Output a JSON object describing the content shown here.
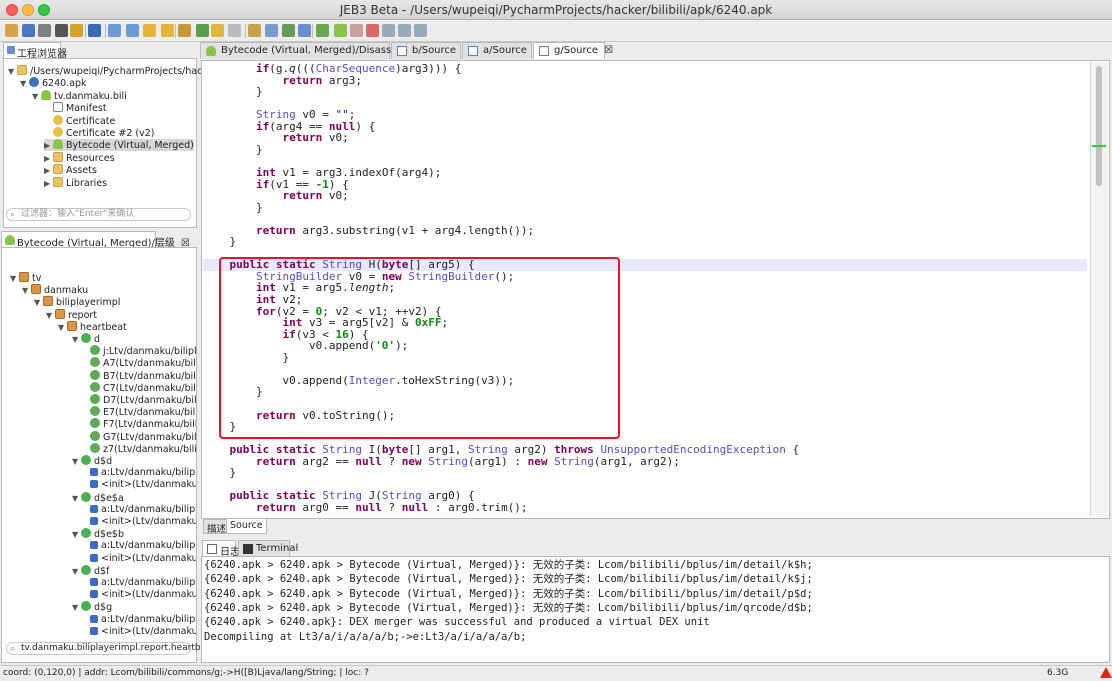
{
  "window": {
    "title": "JEB3 Beta - /Users/wupeiqi/PycharmProjects/hacker/bilibili/apk/6240.apk"
  },
  "toolbar": {
    "icons": [
      "open-folder-icon",
      "save-icon",
      "wrench-icon",
      "hammer-icon",
      "bomb-icon",
      "globe-icon",
      "import-icon",
      "export-icon",
      "back-icon",
      "forward-icon",
      "package-icon",
      "comment-icon",
      "pencil-icon",
      "document-icon",
      "table-icon",
      "copy-icon",
      "graph-icon",
      "stack-icon",
      "debug-icon",
      "play-icon",
      "pause-icon",
      "stop-icon",
      "step-into-icon",
      "step-over-icon",
      "step-out-icon"
    ]
  },
  "project_explorer": {
    "tab_label": "工程浏览器",
    "tree": [
      {
        "label": "/Users/wupeiqi/PycharmProjects/hacker/b",
        "icon": "folder-icon",
        "expanded": true
      },
      {
        "label": "6240.apk",
        "icon": "apk-icon",
        "expanded": true
      },
      {
        "label": "tv.danmaku.bili",
        "icon": "android-icon",
        "expanded": true
      },
      {
        "label": "Manifest",
        "icon": "file-icon"
      },
      {
        "label": "Certificate",
        "icon": "key-icon"
      },
      {
        "label": "Certificate #2 (v2)",
        "icon": "key-icon"
      },
      {
        "label": "Bytecode (Virtual, Merged)",
        "icon": "android-icon",
        "selected": true
      },
      {
        "label": "Resources",
        "icon": "folder-icon"
      },
      {
        "label": "Assets",
        "icon": "folder-icon"
      },
      {
        "label": "Libraries",
        "icon": "folder-icon"
      }
    ],
    "filter_placeholder": "过滤器：输入\"Enter\"来确认"
  },
  "hierarchy": {
    "tab_label": "Bytecode (Virtual, Merged)/层级",
    "close": "☒",
    "tree": [
      {
        "label": "tv",
        "type": "pkg"
      },
      {
        "label": "danmaku",
        "type": "pkg"
      },
      {
        "label": "biliplayerimpl",
        "type": "pkg"
      },
      {
        "label": "report",
        "type": "pkg"
      },
      {
        "label": "heartbeat",
        "type": "pkg"
      },
      {
        "label": "d",
        "type": "class"
      },
      {
        "label": "j:Ltv/danmaku/biliplaye",
        "type": "method"
      },
      {
        "label": "A7(Ltv/danmaku/biliplay",
        "type": "method"
      },
      {
        "label": "B7(Ltv/danmaku/biliplay",
        "type": "method"
      },
      {
        "label": "C7(Ltv/danmaku/biliplay",
        "type": "method"
      },
      {
        "label": "D7(Ltv/danmaku/biliplay",
        "type": "method"
      },
      {
        "label": "E7(Ltv/danmaku/biliplay",
        "type": "method"
      },
      {
        "label": "F7(Ltv/danmaku/biliplay",
        "type": "method"
      },
      {
        "label": "G7(Ltv/danmaku/biliplay",
        "type": "method"
      },
      {
        "label": "z7(Ltv/danmaku/biliplay",
        "type": "method"
      },
      {
        "label": "d$d",
        "type": "class"
      },
      {
        "label": "a:Ltv/danmaku/biliplaye",
        "type": "field"
      },
      {
        "label": "<init>(Ltv/danmaku/bil",
        "type": "init"
      },
      {
        "label": "d$e$a",
        "type": "class"
      },
      {
        "label": "a:Ltv/danmaku/biliplaye",
        "type": "field"
      },
      {
        "label": "<init>(Ltv/danmaku/bil",
        "type": "init"
      },
      {
        "label": "d$e$b",
        "type": "class"
      },
      {
        "label": "a:Ltv/danmaku/biliplaye",
        "type": "field"
      },
      {
        "label": "<init>(Ltv/danmaku/bil",
        "type": "init"
      },
      {
        "label": "d$f",
        "type": "class"
      },
      {
        "label": "a:Ltv/danmaku/biliplaye",
        "type": "field"
      },
      {
        "label": "<init>(Ltv/danmaku/bil",
        "type": "init"
      },
      {
        "label": "d$g",
        "type": "class"
      },
      {
        "label": "a:Ltv/danmaku/biliplaye",
        "type": "field"
      },
      {
        "label": "<init>(Ltv/danmaku/bil",
        "type": "init"
      }
    ],
    "filter_value": "tv.danmaku.biliplayerimpl.report.heartbe"
  },
  "editor_tabs": [
    {
      "label": "Bytecode (Virtual, Merged)/Disassembly",
      "active": false
    },
    {
      "label": "b/Source",
      "active": false
    },
    {
      "label": "a/Source",
      "active": false
    },
    {
      "label": "g/Source",
      "active": true,
      "close": "☒"
    }
  ],
  "bottom_tabs": {
    "describe": "描述",
    "source": "Source"
  },
  "console_tabs": {
    "log": "日志",
    "terminal": "Terminal"
  },
  "console": [
    "{6240.apk > 6240.apk > Bytecode (Virtual, Merged)}: 无效的子类: Lcom/bilibili/bplus/im/detail/k$h;",
    "{6240.apk > 6240.apk > Bytecode (Virtual, Merged)}: 无效的子类: Lcom/bilibili/bplus/im/detail/k$j;",
    "{6240.apk > 6240.apk > Bytecode (Virtual, Merged)}: 无效的子类: Lcom/bilibili/bplus/im/detail/p$d;",
    "{6240.apk > 6240.apk > Bytecode (Virtual, Merged)}: 无效的子类: Lcom/bilibili/bplus/im/qrcode/d$b;",
    "{6240.apk > 6240.apk}: DEX merger was successful and produced a virtual DEX unit",
    "Decompiling at Lt3/a/i/a/a/a/b;->e:Lt3/a/i/a/a/a/b;"
  ],
  "status": {
    "text": "coord: (0,120,0) | addr: Lcom/bilibili/commons/g;->H([B)Ljava/lang/String; | loc: ?",
    "memory": "6.3G"
  },
  "code": [
    [
      [
        "",
        "        "
      ],
      [
        "kw",
        "if"
      ],
      [
        "",
        "(g."
      ],
      [
        "it",
        "q"
      ],
      [
        "",
        "((("
      ],
      [
        "ty",
        "CharSequence"
      ],
      [
        "",
        ")arg3))) {"
      ]
    ],
    [
      [
        "",
        "            "
      ],
      [
        "kw",
        "return"
      ],
      [
        "",
        " arg3;"
      ]
    ],
    [
      [
        "",
        "        }"
      ]
    ],
    [
      [
        "",
        ""
      ]
    ],
    [
      [
        "",
        "        "
      ],
      [
        "ty",
        "String"
      ],
      [
        "",
        " v0 = "
      ],
      [
        "str",
        "\"\""
      ],
      [
        "",
        ";"
      ]
    ],
    [
      [
        "",
        "        "
      ],
      [
        "kw",
        "if"
      ],
      [
        "",
        "(arg4 == "
      ],
      [
        "kw",
        "null"
      ],
      [
        "",
        ") {"
      ]
    ],
    [
      [
        "",
        "            "
      ],
      [
        "kw",
        "return"
      ],
      [
        "",
        " v0;"
      ]
    ],
    [
      [
        "",
        "        }"
      ]
    ],
    [
      [
        "",
        ""
      ]
    ],
    [
      [
        "",
        "        "
      ],
      [
        "kw",
        "int"
      ],
      [
        "",
        " v1 = arg3.indexOf(arg4);"
      ]
    ],
    [
      [
        "",
        "        "
      ],
      [
        "kw",
        "if"
      ],
      [
        "",
        "(v1 == "
      ],
      [
        "num",
        "-1"
      ],
      [
        "",
        ") {"
      ]
    ],
    [
      [
        "",
        "            "
      ],
      [
        "kw",
        "return"
      ],
      [
        "",
        " v0;"
      ]
    ],
    [
      [
        "",
        "        }"
      ]
    ],
    [
      [
        "",
        ""
      ]
    ],
    [
      [
        "",
        "        "
      ],
      [
        "kw",
        "return"
      ],
      [
        "",
        " arg3.substring(v1 + arg4.length());"
      ]
    ],
    [
      [
        "",
        "    }"
      ]
    ],
    [
      [
        "",
        ""
      ]
    ],
    [
      [
        "",
        "    "
      ],
      [
        "kw",
        "public static"
      ],
      [
        " ",
        " "
      ],
      [
        "ty",
        "String"
      ],
      [
        "",
        " H("
      ],
      [
        "kw",
        "byte"
      ],
      [
        "",
        "[] arg5) {"
      ]
    ],
    [
      [
        "",
        "        "
      ],
      [
        "ty",
        "StringBuilder"
      ],
      [
        "",
        " v0 = "
      ],
      [
        "kw",
        "new"
      ],
      [
        " ",
        " "
      ],
      [
        "ty",
        "StringBuilder"
      ],
      [
        "",
        "();"
      ]
    ],
    [
      [
        "",
        "        "
      ],
      [
        "kw",
        "int"
      ],
      [
        "",
        " v1 = arg5."
      ],
      [
        "it",
        "length"
      ],
      [
        "",
        ";"
      ]
    ],
    [
      [
        "",
        "        "
      ],
      [
        "kw",
        "int"
      ],
      [
        "",
        " v2;"
      ]
    ],
    [
      [
        "",
        "        "
      ],
      [
        "kw",
        "for"
      ],
      [
        "",
        "(v2 = "
      ],
      [
        "num",
        "0"
      ],
      [
        "",
        "; v2 < v1; ++v2) {"
      ]
    ],
    [
      [
        "",
        "            "
      ],
      [
        "kw",
        "int"
      ],
      [
        "",
        " v3 = arg5[v2] & "
      ],
      [
        "num",
        "0xFF"
      ],
      [
        "",
        ";"
      ]
    ],
    [
      [
        "",
        "            "
      ],
      [
        "kw",
        "if"
      ],
      [
        "",
        "(v3 < "
      ],
      [
        "num",
        "16"
      ],
      [
        "",
        ") {"
      ]
    ],
    [
      [
        "",
        "                v0.append("
      ],
      [
        "str2",
        "'0'"
      ],
      [
        "",
        ");"
      ]
    ],
    [
      [
        "",
        "            }"
      ]
    ],
    [
      [
        "",
        ""
      ]
    ],
    [
      [
        "",
        "            v0.append("
      ],
      [
        "ty",
        "Integer"
      ],
      [
        "",
        ".toHexString(v3));"
      ]
    ],
    [
      [
        "",
        "        }"
      ]
    ],
    [
      [
        "",
        ""
      ]
    ],
    [
      [
        "",
        "        "
      ],
      [
        "kw",
        "return"
      ],
      [
        "",
        " v0.toString();"
      ]
    ],
    [
      [
        "",
        "    }"
      ]
    ],
    [
      [
        "",
        ""
      ]
    ],
    [
      [
        "",
        "    "
      ],
      [
        "kw",
        "public static"
      ],
      [
        " ",
        " "
      ],
      [
        "ty",
        "String"
      ],
      [
        "",
        " I("
      ],
      [
        "kw",
        "byte"
      ],
      [
        "",
        "[] arg1, "
      ],
      [
        "ty",
        "String"
      ],
      [
        "",
        " arg2) "
      ],
      [
        "kw",
        "throws"
      ],
      [
        " ",
        " "
      ],
      [
        "ty",
        "UnsupportedEncodingException"
      ],
      [
        "",
        " {"
      ]
    ],
    [
      [
        "",
        "        "
      ],
      [
        "kw",
        "return"
      ],
      [
        "",
        " arg2 == "
      ],
      [
        "kw",
        "null"
      ],
      [
        "",
        " ? "
      ],
      [
        "kw",
        "new"
      ],
      [
        " ",
        " "
      ],
      [
        "ty",
        "String"
      ],
      [
        "",
        "(arg1) : "
      ],
      [
        "kw",
        "new"
      ],
      [
        " ",
        " "
      ],
      [
        "ty",
        "String"
      ],
      [
        "",
        "(arg1, arg2);"
      ]
    ],
    [
      [
        "",
        "    }"
      ]
    ],
    [
      [
        "",
        ""
      ]
    ],
    [
      [
        "",
        "    "
      ],
      [
        "kw",
        "public static"
      ],
      [
        " ",
        " "
      ],
      [
        "ty",
        "String"
      ],
      [
        "",
        " J("
      ],
      [
        "ty",
        "String"
      ],
      [
        "",
        " arg0) {"
      ]
    ],
    [
      [
        "",
        "        "
      ],
      [
        "kw",
        "return"
      ],
      [
        "",
        " arg0 == "
      ],
      [
        "kw",
        "null"
      ],
      [
        "",
        " ? "
      ],
      [
        "kw",
        "null"
      ],
      [
        "",
        " : arg0.trim();"
      ]
    ]
  ]
}
